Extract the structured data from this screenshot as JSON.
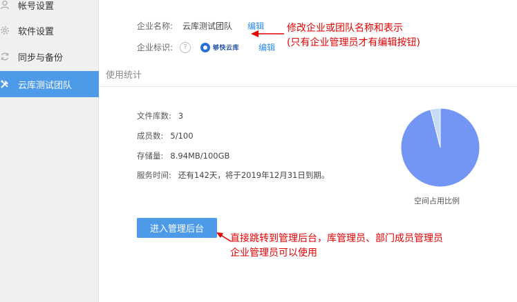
{
  "sidebar": {
    "items": [
      {
        "label": "帐号设置",
        "icon": "user-icon",
        "active": false
      },
      {
        "label": "软件设置",
        "icon": "gear-icon",
        "active": false
      },
      {
        "label": "同步与备份",
        "icon": "sync-icon",
        "active": false
      },
      {
        "label": "云库测试团队",
        "icon": "tools-icon",
        "active": true
      }
    ]
  },
  "company": {
    "name_label": "企业名称:",
    "name_value": "云库测试团队",
    "name_edit": "编辑",
    "logo_label": "企业标识:",
    "help_glyph": "?",
    "logo_text": "够快云库",
    "logo_edit": "编辑"
  },
  "section": {
    "title": "使用统计"
  },
  "stats": {
    "libraries_label": "文件库数:",
    "libraries_value": "3",
    "members_label": "成员数:",
    "members_value": "5/100",
    "storage_label": "存储量:",
    "storage_value": "8.94MB/100GB",
    "service_label": "服务时间:",
    "service_value": "还有142天，将于2019年12月31日到期。"
  },
  "chart_data": {
    "type": "pie",
    "title": "空间占用比例",
    "slices": [
      {
        "label": "",
        "value": 96,
        "color": "#7396f4"
      },
      {
        "label": "",
        "value": 4,
        "color": "#c6dbf6"
      }
    ]
  },
  "admin_button": {
    "label": "进入管理后台"
  },
  "annotations": {
    "top_line1": "修改企业或团队名称和表示",
    "top_line2": "(只有企业管理员才有编辑按钮)",
    "bottom_line1": "直接跳转到管理后台，库管理员、部门成员管理员",
    "bottom_line2": "企业管理员可以使用",
    "color": "#e60000"
  }
}
